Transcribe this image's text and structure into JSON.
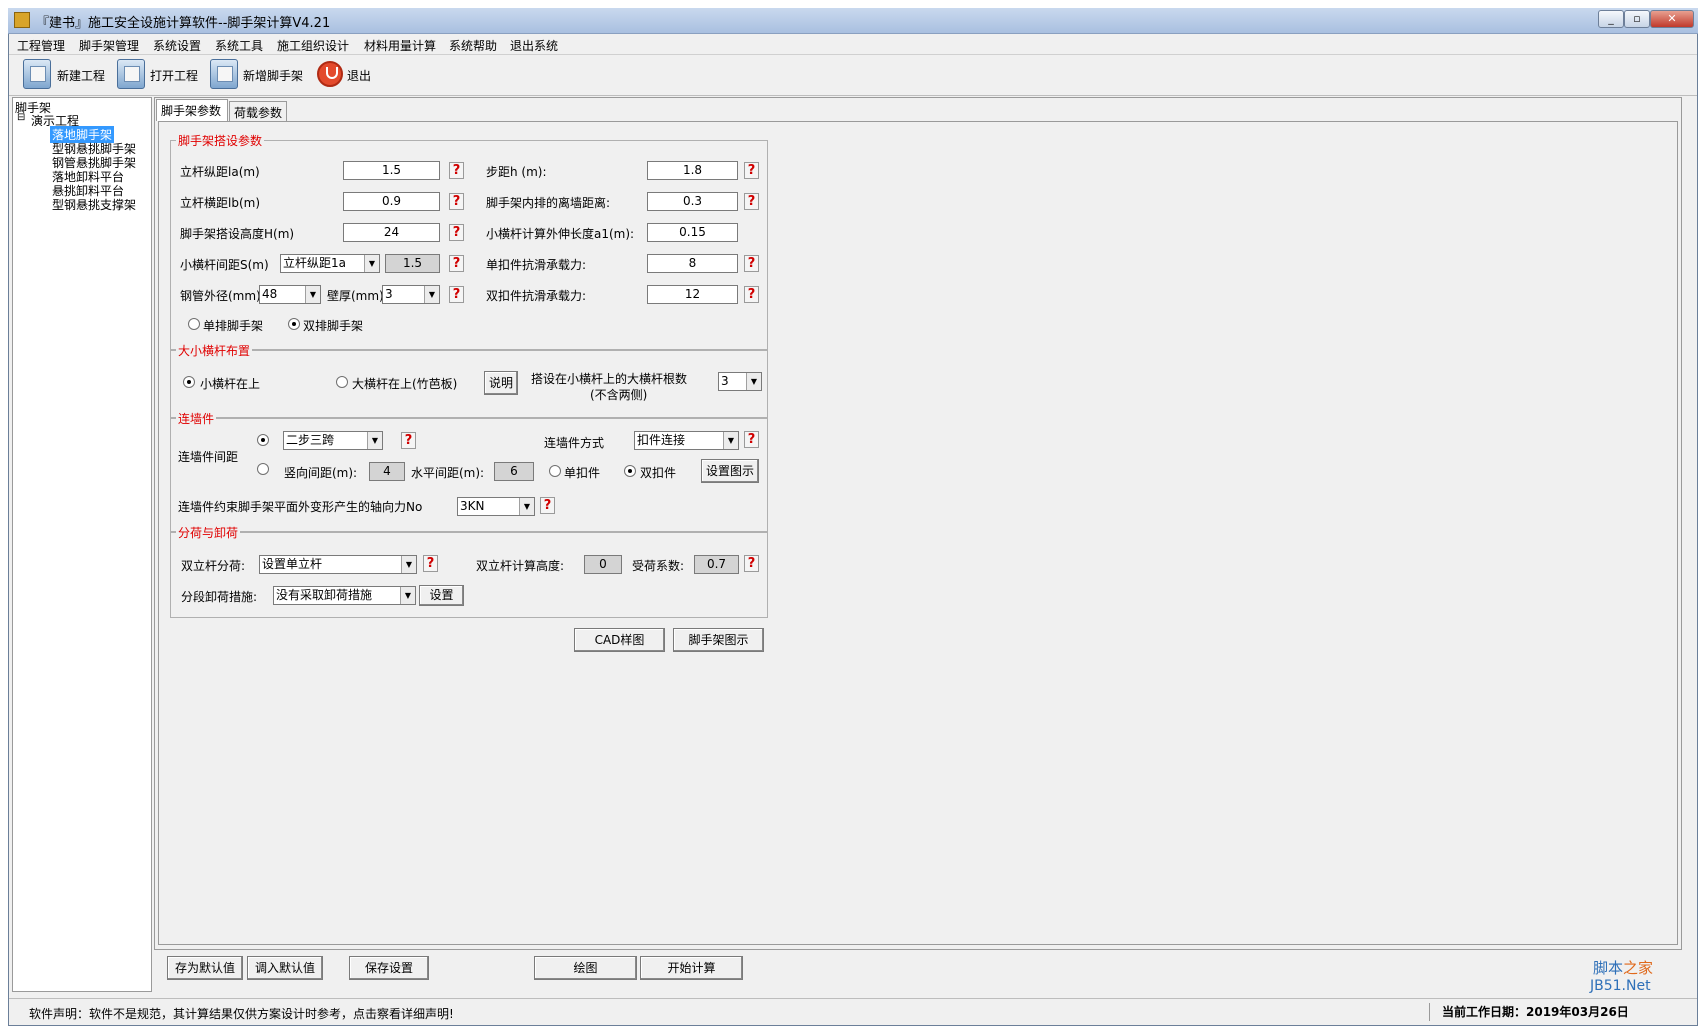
{
  "window": {
    "title": "『建书』施工安全设施计算软件--脚手架计算V4.21"
  },
  "menu": [
    "工程管理",
    "脚手架管理",
    "系统设置",
    "系统工具",
    "施工组织设计",
    "材料用量计算",
    "系统帮助",
    "退出系统"
  ],
  "toolbar": {
    "new": "新建工程",
    "open": "打开工程",
    "add": "新增脚手架",
    "exit": "退出"
  },
  "tree": {
    "root": "脚手架",
    "project": "演示工程",
    "items": [
      "落地脚手架",
      "型钢悬挑脚手架",
      "钢管悬挑脚手架",
      "落地卸料平台",
      "悬挑卸料平台",
      "型钢悬挑支撑架"
    ],
    "collapse_glyph": "⊟"
  },
  "tabs": [
    "脚手架参数",
    "荷载参数"
  ],
  "g1": {
    "title": "脚手架搭设参数",
    "la_label": "立杆纵距la(m)",
    "la": "1.5",
    "lb_label": "立杆横距lb(m)",
    "lb": "0.9",
    "H_label": "脚手架搭设高度H(m)",
    "H": "24",
    "S_label": "小横杆间距S(m)",
    "S_sel": "立杆纵距1a",
    "S": "1.5",
    "dia_label": "钢管外径(mm)",
    "dia": "48",
    "wall_label": "壁厚(mm)",
    "wall": "3",
    "h_label": "步距h (m):",
    "h": "1.8",
    "dist_label": "脚手架内排的离墙距离:",
    "dist": "0.3",
    "a1_label": "小横杆计算外伸长度a1(m):",
    "a1": "0.15",
    "single_label": "单扣件抗滑承载力:",
    "single": "8",
    "double_label": "双扣件抗滑承载力:",
    "double": "12",
    "radio_single": "单排脚手架",
    "radio_double": "双排脚手架"
  },
  "g2": {
    "title": "大小横杆布置",
    "opt1": "小横杆在上",
    "opt2": "大横杆在上(竹芭板)",
    "explain": "说明",
    "count_label1": "搭设在小横杆上的大横杆根数",
    "count_label2": "(不含两侧)",
    "count": "3"
  },
  "g3": {
    "title": "连墙件",
    "spacing_label": "连墙件间距",
    "spacing_sel": "二步三跨",
    "method_label": "连墙件方式",
    "method": "扣件连接",
    "vert_label": "竖向间距(m):",
    "vert": "4",
    "horiz_label": "水平间距(m):",
    "horiz": "6",
    "single": "单扣件",
    "double": "双扣件",
    "fig": "设置图示",
    "force_label": "连墙件约束脚手架平面外变形产生的轴向力No",
    "force": "3KN"
  },
  "g4": {
    "title": "分荷与卸荷",
    "split_label": "双立杆分荷:",
    "split": "设置单立杆",
    "height_label": "双立杆计算高度:",
    "height": "0",
    "coef_label": "受荷系数:",
    "coef": "0.7",
    "unload_label": "分段卸荷措施:",
    "unload": "没有采取卸荷措施",
    "set": "设置"
  },
  "buttons": {
    "cad": "CAD样图",
    "fig": "脚手架图示",
    "save_default": "存为默认值",
    "load_default": "调入默认值",
    "save": "保存设置",
    "draw": "绘图",
    "calc": "开始计算"
  },
  "status": {
    "notice": "软件声明：软件不是规范，其计算结果仅供方案设计时参考，点击察看详细声明!",
    "date": "当前工作日期：2019年03月26日"
  },
  "help_glyph": "?",
  "arrow_glyph": "▼",
  "watermark": {
    "top_a": "脚本",
    "top_b": "之家",
    "bottom": "JB51.Net"
  }
}
